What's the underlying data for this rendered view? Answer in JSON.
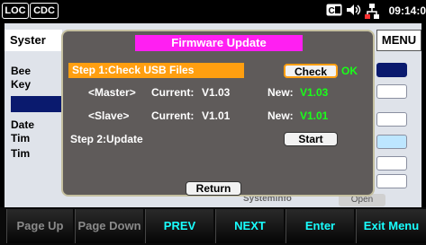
{
  "status_bar": {
    "mode_badges": [
      "LOC",
      "CDC"
    ],
    "icons": [
      "ce-icon",
      "speaker-icon",
      "network-icon"
    ],
    "time": "09:14:0"
  },
  "background": {
    "tab_label": "Syster",
    "menu_label": "MENU",
    "labels": [
      "Bee",
      "Key",
      "Date",
      "Tim",
      "Tim"
    ],
    "system_info_label": "SystemInfo",
    "open_label": "Open"
  },
  "dialog": {
    "title": "Firmware Update",
    "step1_label": "Step 1:Check USB Files",
    "check_button": "Check",
    "check_status": "OK",
    "master": {
      "label": "<Master>",
      "current_label": "Current:",
      "current": "V1.03",
      "new_label": "New:",
      "new": "V1.03"
    },
    "slave": {
      "label": "<Slave>",
      "current_label": "Current:",
      "current": "V1.01",
      "new_label": "New:",
      "new": "V1.01"
    },
    "step2_label": "Step 2:Update",
    "start_button": "Start",
    "return_button": "Return"
  },
  "softkeys": [
    {
      "label": "Page Up",
      "color": "#8a8a8a"
    },
    {
      "label": "Page Down",
      "color": "#8a8a8a"
    },
    {
      "label": "PREV",
      "color": "#19ffff"
    },
    {
      "label": "NEXT",
      "color": "#19ffff"
    },
    {
      "label": "Enter",
      "color": "#19ffff"
    },
    {
      "label": "Exit Menu",
      "color": "#19ffff"
    }
  ],
  "colors": {
    "accent_orange": "#ff9f10",
    "title_magenta": "#ff1ff2",
    "ok_green": "#19ff19",
    "softkey_cyan": "#19ffff"
  }
}
